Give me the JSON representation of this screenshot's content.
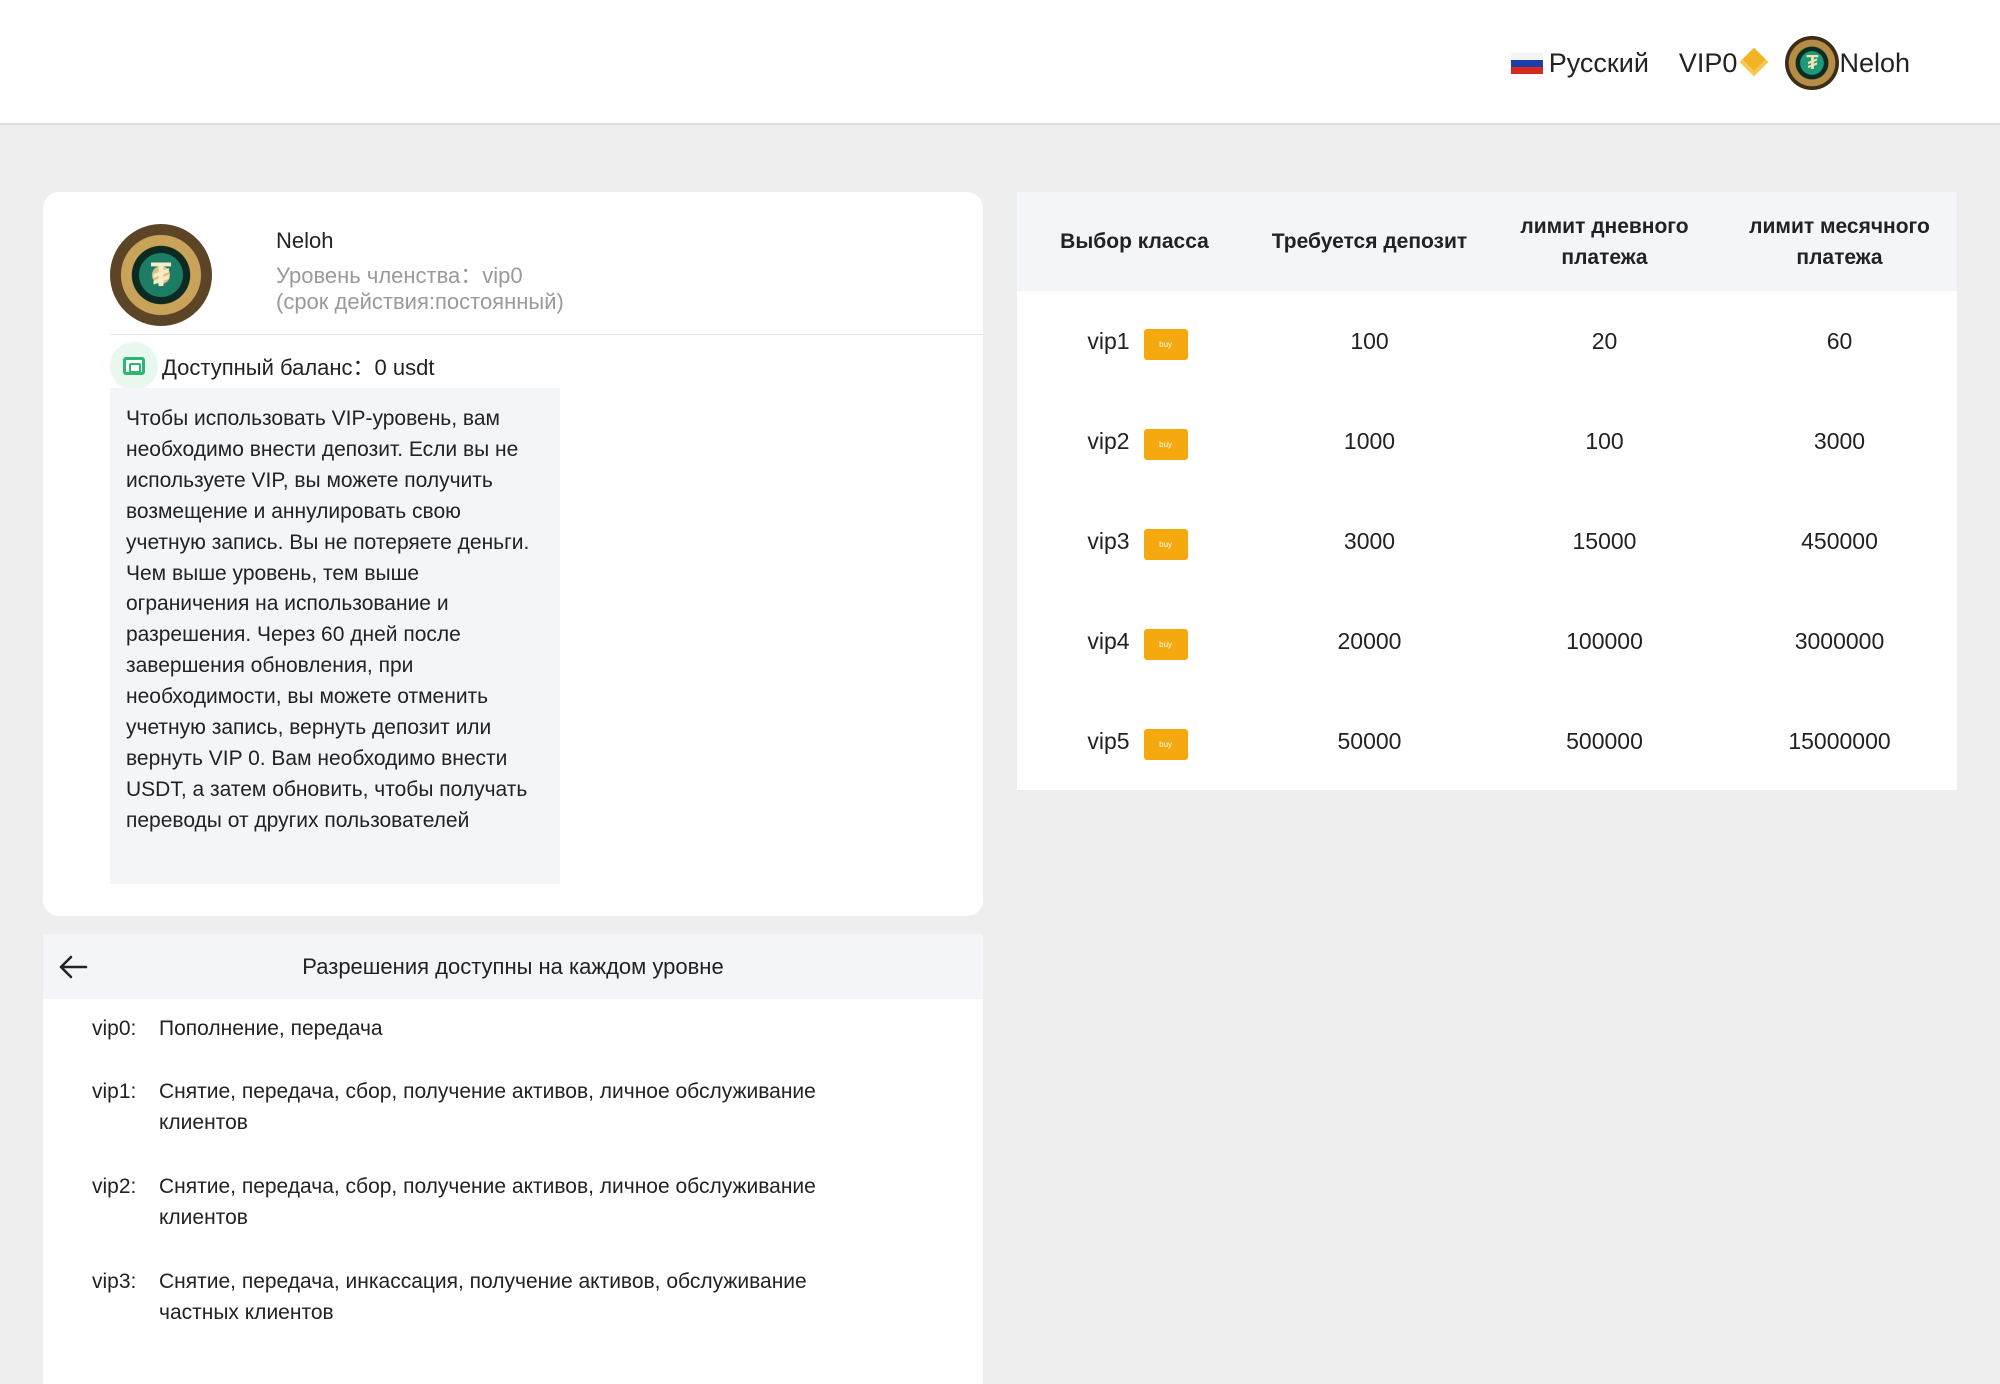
{
  "header": {
    "language": "Русский",
    "vip": "VIP0",
    "username": "Neloh"
  },
  "profile": {
    "name": "Neloh",
    "level_text": "Уровень членства：vip0",
    "term_text": "(срок действия:постоянный)",
    "balance_text": "Доступный баланс：0 usdt",
    "notice": "Чтобы использовать VIP-уровень, вам необходимо внести депозит. Если вы не используете VIP, вы можете получить возмещение и аннулировать свою учетную запись. Вы не потеряете деньги. Чем выше уровень, тем выше ограничения на использование и разрешения. Через 60 дней после завершения обновления, при необходимости, вы можете отменить учетную запись, вернуть депозит или вернуть VIP 0. Вам необходимо внести USDT, а затем обновить, чтобы получать переводы от других пользователей"
  },
  "permissions": {
    "title": "Разрешения доступны на каждом уровне",
    "rows": [
      {
        "key": "vip0:",
        "value": "Пополнение, передача"
      },
      {
        "key": "vip1:",
        "value": "Снятие, передача, сбор, получение активов, личное обслуживание клиентов"
      },
      {
        "key": "vip2:",
        "value": "Снятие, передача, сбор, получение активов, личное обслуживание клиентов"
      },
      {
        "key": "vip3:",
        "value": "Снятие, передача, инкассация, получение активов, обслуживание частных клиентов"
      }
    ]
  },
  "vip_table": {
    "headers": [
      "Выбор класса",
      "Требуется депозит",
      "лимит дневного платежа",
      "лимит месячного платежа"
    ],
    "buy_label": "buy",
    "rows": [
      {
        "level": "vip1",
        "deposit": "100",
        "daily": "20",
        "monthly": "60"
      },
      {
        "level": "vip2",
        "deposit": "1000",
        "daily": "100",
        "monthly": "3000"
      },
      {
        "level": "vip3",
        "deposit": "3000",
        "daily": "15000",
        "monthly": "450000"
      },
      {
        "level": "vip4",
        "deposit": "20000",
        "daily": "100000",
        "monthly": "3000000"
      },
      {
        "level": "vip5",
        "deposit": "50000",
        "daily": "500000",
        "monthly": "15000000"
      }
    ]
  },
  "colors": {
    "accent": "#f5a90e",
    "background": "#eeeeee",
    "panel": "#f4f5f9",
    "muted_text": "#9a9a9a"
  }
}
